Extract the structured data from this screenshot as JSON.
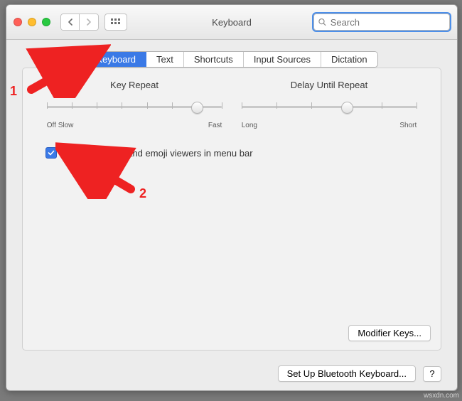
{
  "window_title": "Keyboard",
  "search_placeholder": "Search",
  "tabs": [
    "Keyboard",
    "Text",
    "Shortcuts",
    "Input Sources",
    "Dictation"
  ],
  "active_tab_index": 0,
  "sliders": {
    "key_repeat": {
      "title": "Key Repeat",
      "left_label_1": "Off",
      "left_label_2": "Slow",
      "right_label": "Fast",
      "ticks": 8,
      "value_index": 6
    },
    "delay_until_repeat": {
      "title": "Delay Until Repeat",
      "left_label": "Long",
      "right_label": "Short",
      "ticks": 6,
      "value_index": 3
    }
  },
  "checkbox": {
    "checked": true,
    "label": "Show keyboard and emoji viewers in menu bar"
  },
  "modifier_button": "Modifier Keys...",
  "bluetooth_button": "Set Up Bluetooth Keyboard...",
  "help_button": "?",
  "annotations": {
    "one": "1",
    "two": "2"
  },
  "watermark": "wsxdn.com"
}
